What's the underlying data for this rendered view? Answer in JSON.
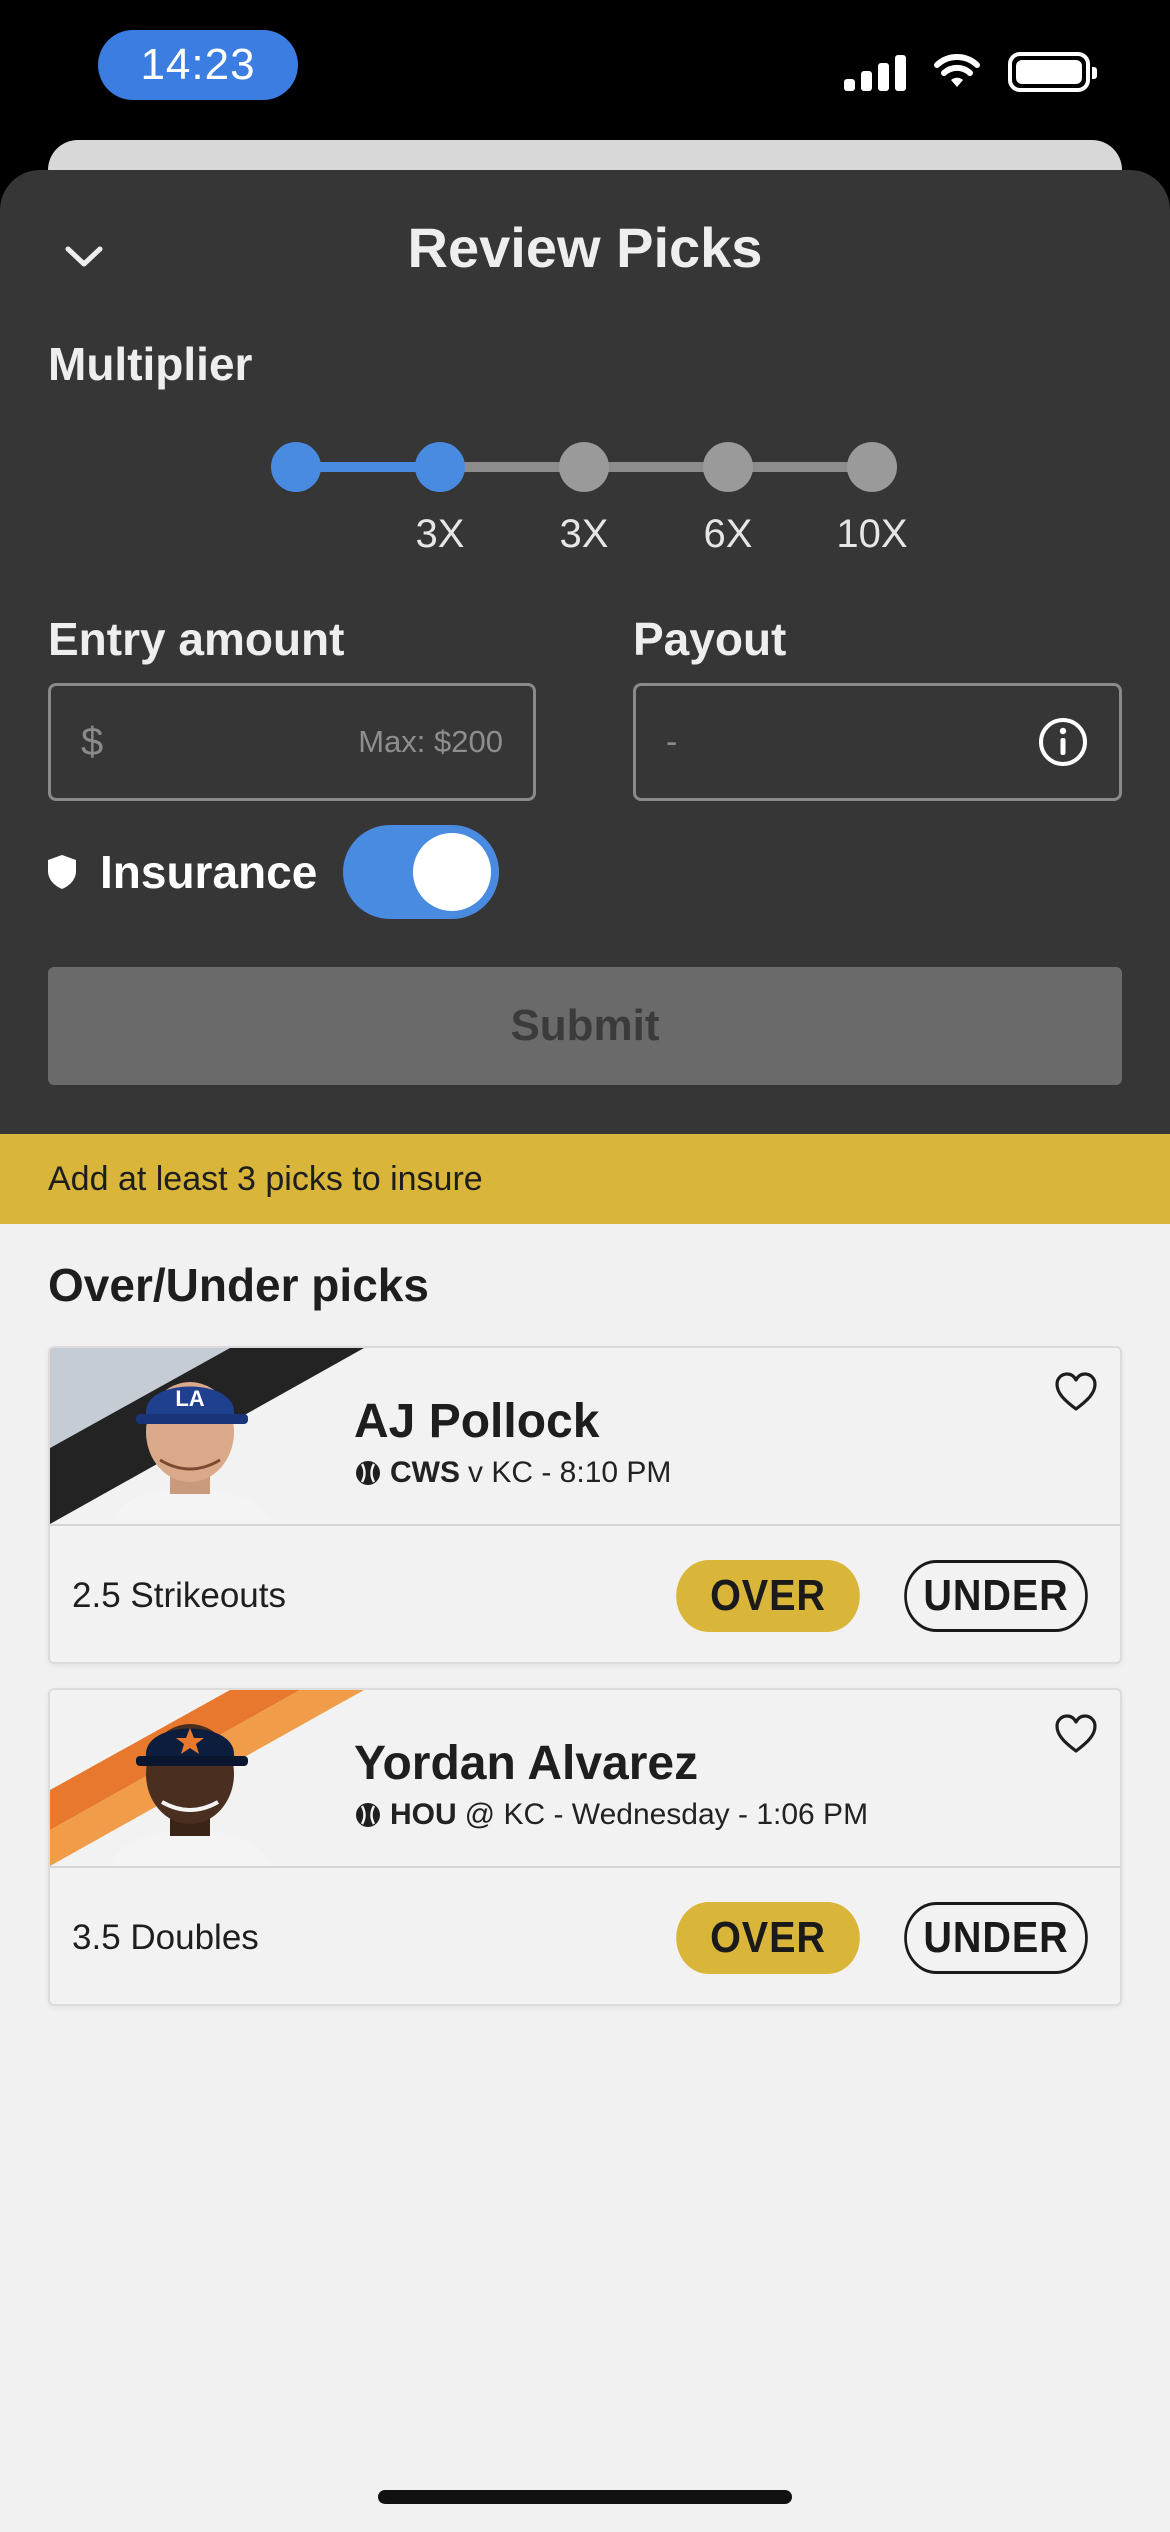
{
  "status_bar": {
    "time": "14:23"
  },
  "sheet": {
    "title": "Review Picks",
    "multiplier": {
      "label": "Multiplier",
      "selected_index": 1,
      "stops": [
        "",
        "3X",
        "3X",
        "6X",
        "10X"
      ]
    },
    "entry": {
      "label": "Entry amount",
      "currency_symbol": "$",
      "max_hint": "Max: $200"
    },
    "payout": {
      "label": "Payout",
      "value": "-"
    },
    "insurance": {
      "label": "Insurance",
      "enabled": true
    },
    "submit_label": "Submit"
  },
  "banner": {
    "text": "Add at least 3 picks to insure"
  },
  "picks": {
    "title": "Over/Under picks",
    "items": [
      {
        "player": "AJ Pollock",
        "team": "CWS",
        "matchup": "v KC - 8:10 PM",
        "stat": "2.5 Strikeouts",
        "over_label": "OVER",
        "under_label": "UNDER",
        "colors": {
          "stripe_a": "#c5ccd3",
          "stripe_b": "#232323",
          "cap": "#1f3f8f"
        }
      },
      {
        "player": "Yordan Alvarez",
        "team": "HOU",
        "matchup": "@ KC - Wednesday - 1:06 PM",
        "stat": "3.5 Doubles",
        "over_label": "OVER",
        "under_label": "UNDER",
        "colors": {
          "stripe_a": "#e8782e",
          "stripe_b": "#f09c48",
          "cap": "#0c1d3d"
        }
      }
    ]
  },
  "colors": {
    "accent_blue": "#4a8be2",
    "accent_gold": "#d9b53a",
    "sheet_dark": "#363636"
  }
}
